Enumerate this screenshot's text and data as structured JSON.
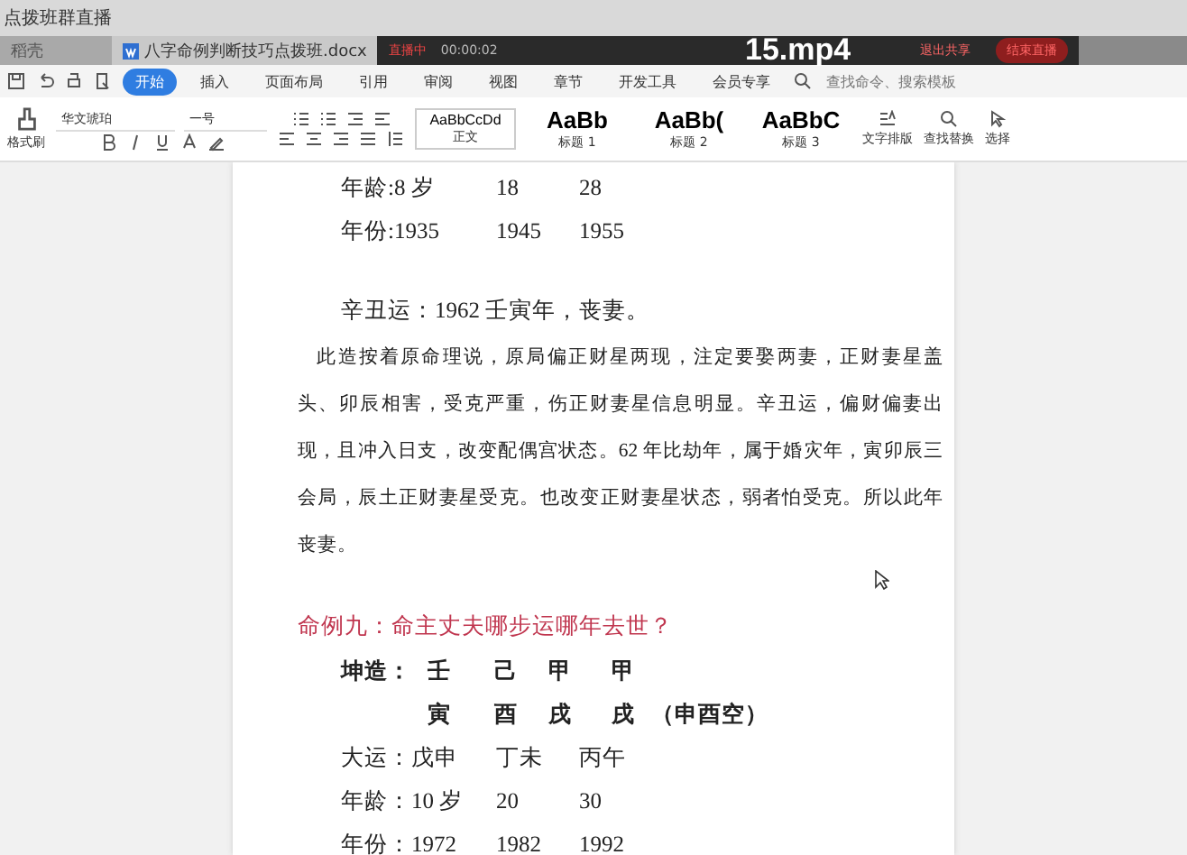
{
  "window": {
    "title": "点拨班群直播"
  },
  "tabs": [
    {
      "label": "稻壳",
      "selected": false
    },
    {
      "label": "八字命例判断技巧点拨班.docx",
      "selected": true
    }
  ],
  "recording_bar": {
    "status": "直播中",
    "time": "00:00:02",
    "buttons": [
      {
        "label": "退出共享",
        "kind": "link"
      },
      {
        "label": "结束直播",
        "kind": "primary"
      }
    ]
  },
  "video_title": "15.mp4",
  "menu": [
    {
      "label": "开始",
      "selected": true
    },
    {
      "label": "插入",
      "selected": false
    },
    {
      "label": "页面布局",
      "selected": false
    },
    {
      "label": "引用",
      "selected": false
    },
    {
      "label": "审阅",
      "selected": false
    },
    {
      "label": "视图",
      "selected": false
    },
    {
      "label": "章节",
      "selected": false
    },
    {
      "label": "开发工具",
      "selected": false
    },
    {
      "label": "会员专享",
      "selected": false
    }
  ],
  "search": {
    "placeholder": "查找命令、搜索模板"
  },
  "ribbon": {
    "format_painter": "格式刷",
    "font": "华文琥珀",
    "size": "一号",
    "styles": [
      {
        "preview": "AaBbCcDd",
        "name": "正文",
        "selected": true
      },
      {
        "preview": "AaBb",
        "name": "标题 1",
        "selected": false
      },
      {
        "preview": "AaBb(",
        "name": "标题 2",
        "selected": false
      },
      {
        "preview": "AaBbC",
        "name": "标题 3",
        "selected": false
      }
    ],
    "actions": [
      {
        "label": "文字排版",
        "kind": "layout"
      },
      {
        "label": "查找替换",
        "kind": "find"
      },
      {
        "label": "选择",
        "kind": "select"
      }
    ]
  },
  "document": [
    {
      "kind": "row",
      "cells": [
        "年龄:8 岁",
        "18",
        "28"
      ]
    },
    {
      "kind": "row",
      "cells": [
        "年份:1935",
        "1945",
        "1955"
      ]
    },
    {
      "kind": "blank"
    },
    {
      "kind": "line",
      "text": "辛丑运：1962 壬寅年，丧妻。"
    },
    {
      "kind": "para",
      "text": "此造按着原命理说，原局偏正财星两现，注定要娶两妻，正财妻星盖头、卯辰相害，受克严重，伤正财妻星信息明显。辛丑运，偏财偏妻出现，且冲入日支，改变配偶宫状态。62 年比劫年，属于婚灾年，寅卯辰三会局，辰土正财妻星受克。也改变正财妻星状态，弱者怕受克。所以此年丧妻。"
    },
    {
      "kind": "blank"
    },
    {
      "kind": "heading",
      "text": "命例九：命主丈夫哪步运哪年去世？"
    },
    {
      "kind": "pillars",
      "label": "坤造：",
      "chars": [
        "壬",
        "己",
        "甲",
        "甲"
      ]
    },
    {
      "kind": "pillars",
      "chars": [
        "寅",
        "酉",
        "戌",
        "戌"
      ],
      "note": "（申酉空）"
    },
    {
      "kind": "row",
      "cells": [
        "大运：戊申",
        "丁未",
        "丙午"
      ]
    },
    {
      "kind": "row",
      "cells": [
        "年龄：10 岁",
        "20",
        "30"
      ]
    },
    {
      "kind": "row",
      "cells": [
        "年份：1972",
        "1982",
        "1992"
      ]
    }
  ]
}
